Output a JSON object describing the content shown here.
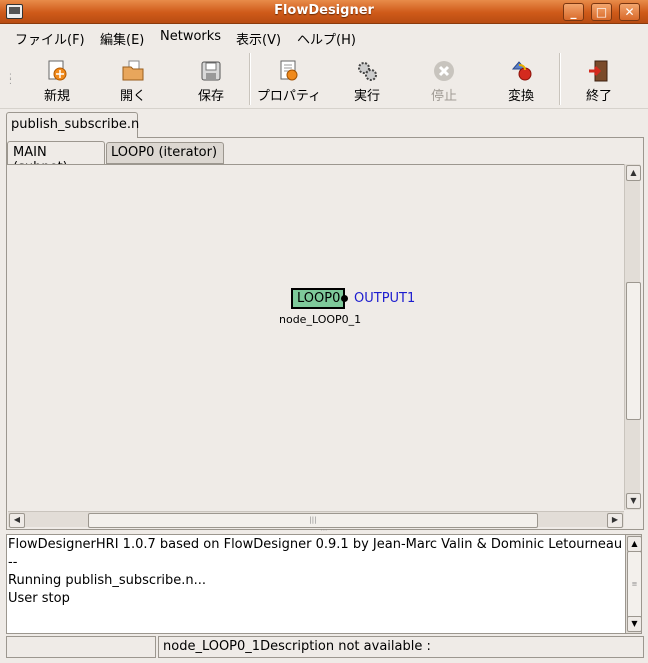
{
  "window": {
    "title": "FlowDesigner"
  },
  "menubar": {
    "items": [
      "ファイル(F)",
      "編集(E)",
      "Networks",
      "表示(V)",
      "ヘルプ(H)"
    ]
  },
  "toolbar": {
    "new": "新規",
    "open": "開く",
    "save": "保存",
    "properties": "プロパティ",
    "run": "実行",
    "stop": "停止",
    "convert": "変換",
    "quit": "終了"
  },
  "document_tab": "publish_subscribe.n",
  "subtabs": [
    "MAIN (subnet)",
    "LOOP0 (iterator)"
  ],
  "node": {
    "type": "LOOP0",
    "output": "OUTPUT1",
    "name": "node_LOOP0_1",
    "color": "#7ec99a"
  },
  "log": {
    "lines": [
      "FlowDesignerHRI 1.0.7 based on FlowDesigner 0.9.1 by Jean-Marc Valin & Dominic Letourneau",
      "--",
      "Running publish_subscribe.n...",
      "User stop"
    ]
  },
  "statusbar": {
    "left": "",
    "message": "node_LOOP0_1Description not available :"
  }
}
